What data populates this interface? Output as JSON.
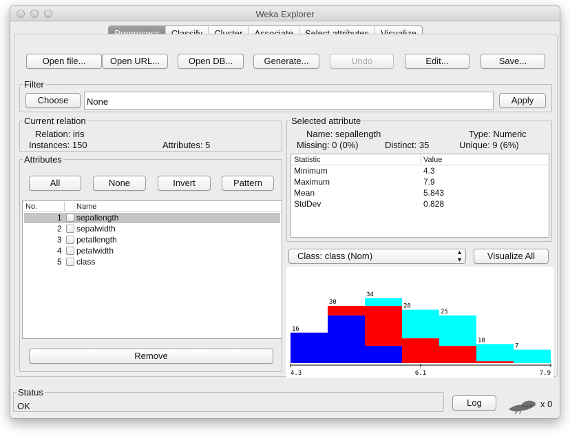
{
  "window": {
    "title": "Weka Explorer"
  },
  "tabs": [
    "Preprocess",
    "Classify",
    "Cluster",
    "Associate",
    "Select attributes",
    "Visualize"
  ],
  "toolbar": {
    "open_file": "Open file...",
    "open_url": "Open URL...",
    "open_db": "Open DB...",
    "generate": "Generate...",
    "undo": "Undo",
    "edit": "Edit...",
    "save": "Save..."
  },
  "filter": {
    "legend": "Filter",
    "choose": "Choose",
    "value": "None",
    "apply": "Apply"
  },
  "current_relation": {
    "legend": "Current relation",
    "relation": "Relation: iris",
    "instances": "Instances: 150",
    "attributes": "Attributes: 5"
  },
  "attributes": {
    "legend": "Attributes",
    "btn_all": "All",
    "btn_none": "None",
    "btn_invert": "Invert",
    "btn_pattern": "Pattern",
    "col_no": "No.",
    "col_name": "Name",
    "rows": [
      {
        "no": "1",
        "name": "sepallength"
      },
      {
        "no": "2",
        "name": "sepalwidth"
      },
      {
        "no": "3",
        "name": "petallength"
      },
      {
        "no": "4",
        "name": "petalwidth"
      },
      {
        "no": "5",
        "name": "class"
      }
    ],
    "remove": "Remove"
  },
  "selected_attribute": {
    "legend": "Selected attribute",
    "name": "Name: sepallength",
    "type": "Type: Numeric",
    "missing": "Missing: 0 (0%)",
    "distinct": "Distinct: 35",
    "unique": "Unique: 9 (6%)",
    "col_statistic": "Statistic",
    "col_value": "Value",
    "stats": [
      {
        "k": "Minimum",
        "v": "4.3"
      },
      {
        "k": "Maximum",
        "v": "7.9"
      },
      {
        "k": "Mean",
        "v": "5.843"
      },
      {
        "k": "StdDev",
        "v": "0.828"
      }
    ]
  },
  "class_select": {
    "value": "Class: class (Nom)",
    "visualize_all": "Visualize All"
  },
  "histogram": {
    "colors": {
      "c1": "#0000ff",
      "c2": "#ff0000",
      "c3": "#00ffff"
    },
    "bins": [
      {
        "total": 16,
        "parts": [
          16,
          0,
          0
        ]
      },
      {
        "total": 30,
        "parts": [
          25,
          5,
          0
        ]
      },
      {
        "total": 34,
        "parts": [
          9,
          21,
          4
        ]
      },
      {
        "total": 28,
        "parts": [
          0,
          13,
          15
        ]
      },
      {
        "total": 25,
        "parts": [
          0,
          9,
          16
        ]
      },
      {
        "total": 10,
        "parts": [
          0,
          1,
          9
        ]
      },
      {
        "total": 7,
        "parts": [
          0,
          0,
          7
        ]
      }
    ],
    "xmin": "4.3",
    "xmid": "6.1",
    "xmax": "7.9"
  },
  "status": {
    "legend": "Status",
    "text": "OK",
    "log": "Log",
    "count": "x 0"
  }
}
